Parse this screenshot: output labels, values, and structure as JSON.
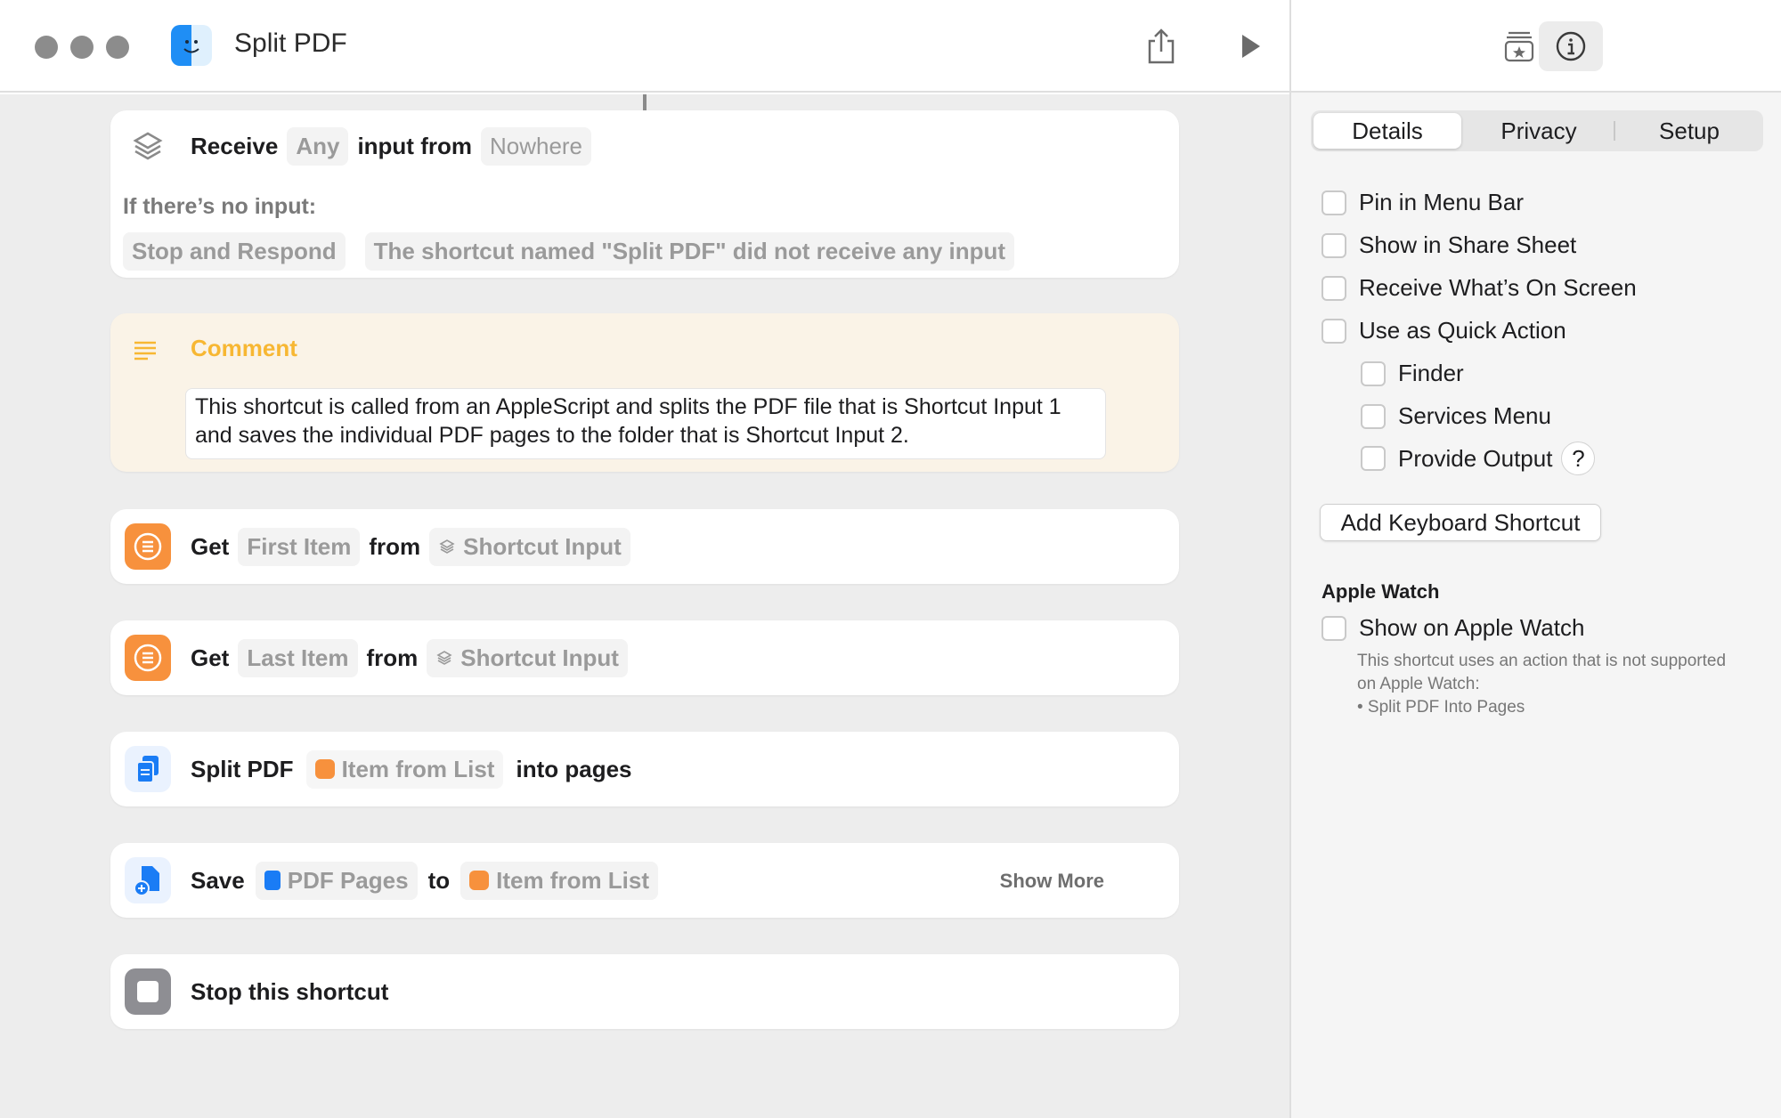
{
  "window": {
    "title": "Split PDF"
  },
  "toolbar": {
    "share_icon": "share-icon",
    "run_icon": "play-icon"
  },
  "actions": {
    "receive": {
      "kw_receive": "Receive",
      "tok_any": "Any",
      "kw_input_from": "input from",
      "tok_nowhere": "Nowhere",
      "no_input_label": "If there’s no input:",
      "tok_stop_respond": "Stop and Respond",
      "tok_message": "The shortcut named \"Split PDF\" did not receive any input"
    },
    "comment": {
      "title": "Comment",
      "text": "This shortcut is called from an AppleScript and splits the PDF file that is Shortcut Input 1 and saves the individual PDF pages to the folder that is Shortcut Input 2."
    },
    "get_first": {
      "kw_get": "Get",
      "tok_item": "First Item",
      "kw_from": "from",
      "tok_source": "Shortcut Input"
    },
    "get_last": {
      "kw_get": "Get",
      "tok_item": "Last Item",
      "kw_from": "from",
      "tok_source": "Shortcut Input"
    },
    "split": {
      "kw_split": "Split PDF",
      "tok_item": "Item from List",
      "kw_into": "into pages"
    },
    "save": {
      "kw_save": "Save",
      "tok_pages": "PDF Pages",
      "kw_to": "to",
      "tok_dest": "Item from List",
      "show_more": "Show More"
    },
    "stop": {
      "kw_stop": "Stop this shortcut"
    }
  },
  "panel": {
    "tabs": [
      "Details",
      "Privacy",
      "Setup"
    ],
    "selected_tab": "Details",
    "options": {
      "pin_menu_bar": "Pin in Menu Bar",
      "share_sheet": "Show in Share Sheet",
      "receive_screen": "Receive What’s On Screen",
      "quick_action": "Use as Quick Action",
      "finder": "Finder",
      "services_menu": "Services Menu",
      "provide_output": "Provide Output",
      "help": "?"
    },
    "add_keyboard_shortcut": "Add Keyboard Shortcut",
    "apple_watch": {
      "heading": "Apple Watch",
      "show_on_watch": "Show on Apple Watch",
      "note_line1": "This shortcut uses an action that is not supported on Apple Watch:",
      "note_line2": "• Split PDF Into Pages"
    }
  },
  "colors": {
    "accent_orange": "#f7913d",
    "accent_blue": "#1a7cf5",
    "comment_yellow": "#f7b733",
    "stop_gray": "#8e8e93"
  }
}
